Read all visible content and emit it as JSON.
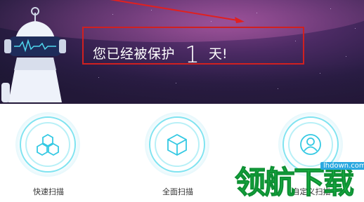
{
  "banner": {
    "message_prefix": "您已经被保护",
    "days": "1",
    "message_suffix": "天!"
  },
  "features": [
    {
      "label": "快速扫描",
      "icon": "hexagon-cluster-icon"
    },
    {
      "label": "全面扫描",
      "icon": "cube-icon"
    },
    {
      "label": "自定义扫描",
      "icon": "user-target-icon"
    }
  ],
  "watermark": {
    "text": "领航下载",
    "url": "lhdown.com"
  },
  "colors": {
    "accent_cyan": "#55dbee",
    "highlight_red": "#d02020",
    "watermark_green": "#1bbd4a"
  }
}
